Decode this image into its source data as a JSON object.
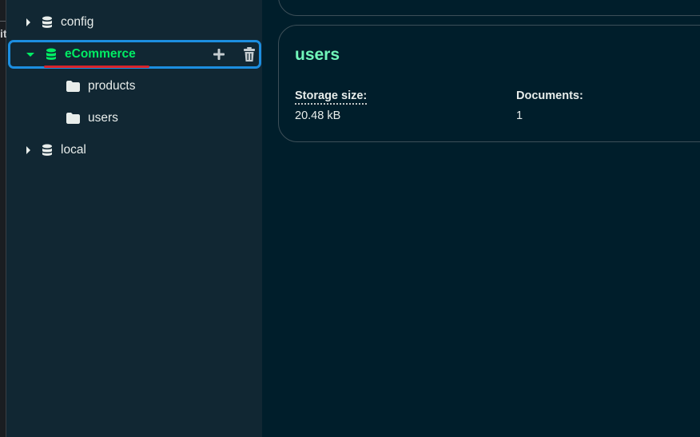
{
  "edge": {
    "glyph": "it"
  },
  "sidebar": {
    "items": [
      {
        "label": "config"
      },
      {
        "label": "eCommerce"
      },
      {
        "label": "products"
      },
      {
        "label": "users"
      },
      {
        "label": "local"
      }
    ]
  },
  "main": {
    "card": {
      "title": "users",
      "stats": [
        {
          "label": "Storage size:",
          "value": "20.48 kB"
        },
        {
          "label": "Documents:",
          "value": "1"
        }
      ]
    }
  },
  "colors": {
    "background": "#001E2B",
    "sidebar": "#112733",
    "accent_green": "#00ED64",
    "card_title": "#71F6BA",
    "focus_ring": "#1c8ee0",
    "underline": "#d8232a"
  },
  "icons": [
    "database-icon",
    "folder-icon",
    "plus-icon",
    "trash-icon",
    "chevron-right-icon",
    "chevron-down-icon"
  ]
}
